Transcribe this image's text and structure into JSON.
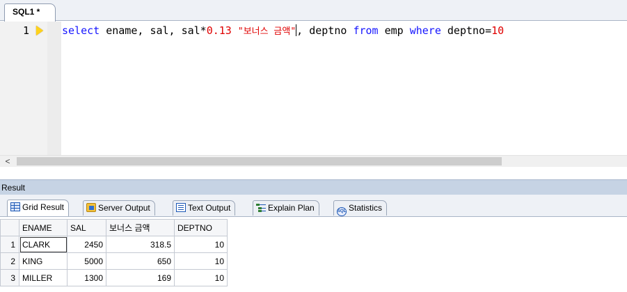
{
  "editor": {
    "tab_label": "SQL1 *",
    "line_number": "1",
    "code_tokens": [
      {
        "t": "select",
        "c": "kw"
      },
      {
        "t": " ",
        "c": "id"
      },
      {
        "t": "ename",
        "c": "id"
      },
      {
        "t": ", ",
        "c": "id"
      },
      {
        "t": "sal",
        "c": "id"
      },
      {
        "t": ", ",
        "c": "id"
      },
      {
        "t": "sal*",
        "c": "id"
      },
      {
        "t": "0.13",
        "c": "num"
      },
      {
        "t": " ",
        "c": "id"
      },
      {
        "t": "\"보너스 금액\"",
        "c": "str"
      },
      {
        "t": "",
        "c": "caret"
      },
      {
        "t": ", deptno ",
        "c": "id"
      },
      {
        "t": "from",
        "c": "kw"
      },
      {
        "t": " emp ",
        "c": "id"
      },
      {
        "t": "where",
        "c": "kw"
      },
      {
        "t": " deptno=",
        "c": "id"
      },
      {
        "t": "10",
        "c": "num"
      }
    ],
    "scroll_left_glyph": "<"
  },
  "result_panel": {
    "title": "Result",
    "tabs": [
      {
        "label": "Grid Result",
        "icon": "grid-icon",
        "active": true
      },
      {
        "label": "Server Output",
        "icon": "server-output-icon",
        "active": false
      },
      {
        "label": "Text Output",
        "icon": "text-output-icon",
        "active": false
      },
      {
        "label": "Explain Plan",
        "icon": "explain-plan-icon",
        "active": false
      },
      {
        "label": "Statistics",
        "icon": "statistics-icon",
        "active": false
      }
    ],
    "stat_icon_text": "SQL"
  },
  "grid": {
    "columns": [
      "ENAME",
      "SAL",
      "보너스 금액",
      "DEPTNO"
    ],
    "rows": [
      {
        "num": "1",
        "cells": [
          "CLARK",
          "2450",
          "318.5",
          "10"
        ]
      },
      {
        "num": "2",
        "cells": [
          "KING",
          "5000",
          "650",
          "10"
        ]
      },
      {
        "num": "3",
        "cells": [
          "MILLER",
          "1300",
          "169",
          "10"
        ]
      }
    ]
  }
}
